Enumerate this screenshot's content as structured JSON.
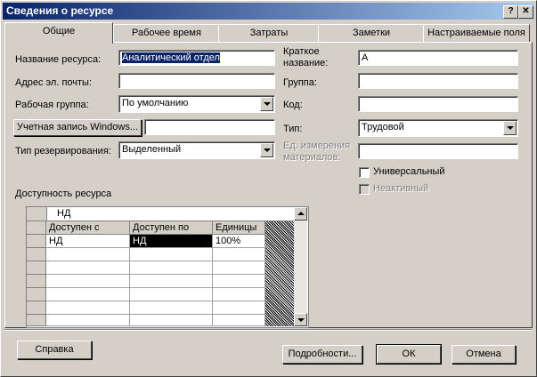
{
  "window": {
    "title": "Сведения о ресурсе",
    "help_btn": "?",
    "close_btn": "✕"
  },
  "tabs": [
    "Общие",
    "Рабочее время",
    "Затраты",
    "Заметки",
    "Настраиваемые поля"
  ],
  "form": {
    "resource_name_label": "Название ресурса:",
    "resource_name_value": "Аналитический отдел",
    "email_label": "Адрес эл. почты:",
    "email_value": "",
    "workgroup_label": "Рабочая группа:",
    "workgroup_value": "По умолчанию",
    "windows_account_btn": "Учетная запись Windows...",
    "windows_account_value": "",
    "booking_type_label": "Тип резервирования:",
    "booking_type_value": "Выделенный",
    "short_name_label_1": "Краткое",
    "short_name_label_2": "название:",
    "short_name_value": "А",
    "group_label": "Группа:",
    "group_value": "",
    "code_label": "Код:",
    "code_value": "",
    "type_label": "Тип:",
    "type_value": "Трудовой",
    "material_units_label_1": "Ед. измерения",
    "material_units_label_2": "материалов:",
    "material_units_value": "",
    "generic_label": "Универсальный",
    "inactive_label": "Неактивный"
  },
  "availability": {
    "label": "Доступность ресурса",
    "edit_value": "НД",
    "columns": [
      "Доступен с",
      "Доступен по",
      "Единицы"
    ],
    "rows": [
      [
        "НД",
        "НД",
        "100%"
      ],
      [
        "",
        "",
        ""
      ],
      [
        "",
        "",
        ""
      ],
      [
        "",
        "",
        ""
      ],
      [
        "",
        "",
        ""
      ],
      [
        "",
        "",
        ""
      ],
      [
        "",
        "",
        ""
      ]
    ]
  },
  "buttons": {
    "help": "Справка",
    "details": "Подробности...",
    "ok": "ОК",
    "cancel": "Отмена"
  }
}
